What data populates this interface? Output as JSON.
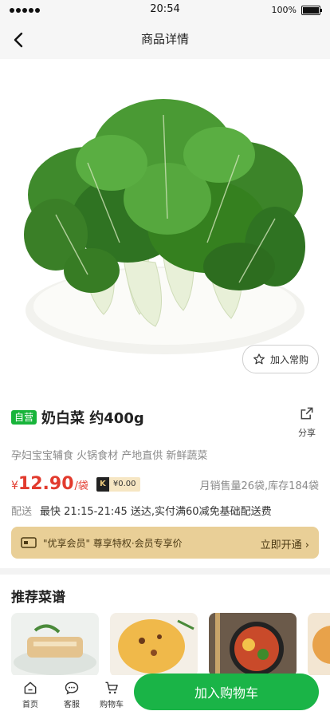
{
  "status_bar": {
    "time": "20:54",
    "battery": "100%",
    "battery_level": 1.0
  },
  "nav": {
    "title": "商品详情"
  },
  "hero": {
    "favorite_label": "加入常购"
  },
  "product": {
    "badge": "自营",
    "name": "奶白菜 约400g",
    "share_label": "分享",
    "subtitle": "孕妇宝宝辅食 火锅食材 产地直供 新鲜蔬菜",
    "currency": "¥",
    "price": "12.90",
    "unit": "/袋",
    "member_tag_letter": "K",
    "member_price": "¥0.00",
    "sales": "月销售量26袋,库存184袋"
  },
  "delivery": {
    "label": "配送",
    "text": "最快 21:15-21:45 送达,实付满60减免基础配送费"
  },
  "vip": {
    "text": "\"优享会员\" 尊享特权·会员专享价",
    "cta": "立即开通"
  },
  "recipes": {
    "title": "推荐菜谱"
  },
  "bottom_nav": {
    "tabs": [
      {
        "label": "首页",
        "icon": "home-icon"
      },
      {
        "label": "客服",
        "icon": "chat-icon"
      },
      {
        "label": "购物车",
        "icon": "cart-icon"
      }
    ],
    "add_to_cart": "加入购物车"
  },
  "colors": {
    "accent_green": "#1ab447",
    "price_red": "#e23b2e",
    "vip_gold": "#e9cf97"
  }
}
